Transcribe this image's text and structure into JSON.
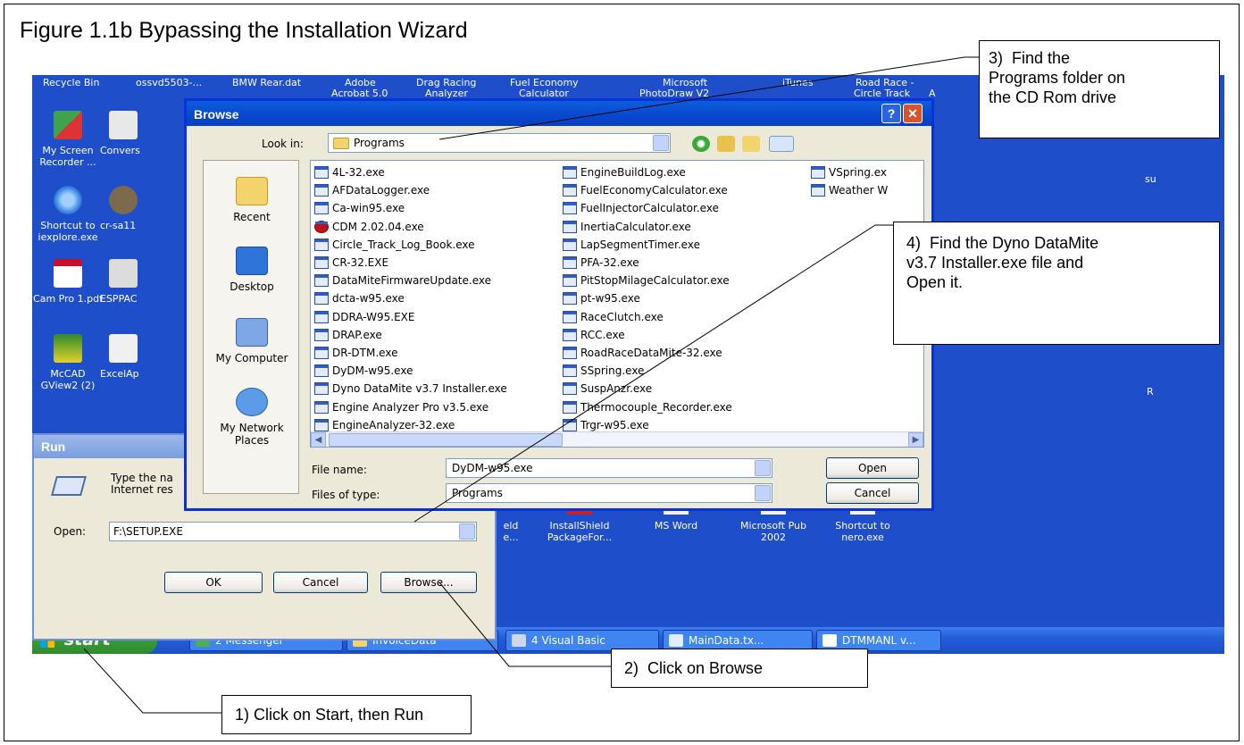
{
  "figure": {
    "title": "Figure 1.1b  Bypassing the Installation Wizard"
  },
  "desktop": {
    "top_row": [
      "Recycle Bin",
      "ossvd5503-...",
      "BMW Rear.dat",
      "Adobe",
      "Drag Racing",
      "Fuel Economy",
      "Microsoft",
      "iTunes",
      "Road Race -"
    ],
    "top_row_sub": [
      "Acrobat 5.0",
      "Analyzer",
      "Calculator",
      "PhotoDraw V2",
      "Circle Track"
    ],
    "icons": [
      {
        "label": "My Screen Recorder ...",
        "name": "screen-recorder-icon"
      },
      {
        "label": "Convers",
        "name": "converter-icon"
      },
      {
        "label": "Shortcut to iexplore.exe",
        "name": "internet-explorer-icon"
      },
      {
        "label": "cr-sa11",
        "name": "cr-sa11-icon"
      },
      {
        "label": "Cam Pro 1.pdf",
        "name": "pdf-icon"
      },
      {
        "label": "ESPPAC",
        "name": "esppac-icon"
      },
      {
        "label": "McCAD GView2 (2)",
        "name": "mccad-icon"
      },
      {
        "label": "ExcelAp",
        "name": "excel-icon"
      }
    ],
    "bottom_icons": [
      "eld",
      "InstallShield PackageFor...",
      "MS Word",
      "Microsoft Pub 2002",
      "Shortcut to nero.exe"
    ],
    "bottom_icons_sub": [
      "e..."
    ],
    "edge_chars": [
      "A",
      "su",
      "R"
    ]
  },
  "taskbar": {
    "start_label": "start",
    "tasks": [
      "2 Messenger",
      "InvoiceData",
      "4 Visual Basic",
      "MainData.tx...",
      "DTMMANL v..."
    ]
  },
  "run_dialog": {
    "title": "Run",
    "description_line1": "Type the na",
    "description_line2": "Internet res",
    "open_label": "Open:",
    "open_value": "F:\\SETUP.EXE",
    "ok_label": "OK",
    "cancel_label": "Cancel",
    "browse_label": "Browse..."
  },
  "browse_dialog": {
    "title": "Browse",
    "help_label": "?",
    "close_label": "✕",
    "look_in_label": "Look in:",
    "look_in_value": "Programs",
    "places": [
      "Recent",
      "Desktop",
      "My Computer",
      "My Network Places"
    ],
    "files_col1": [
      "4L-32.exe",
      "AFDataLogger.exe",
      "Ca-win95.exe",
      "CDM 2.02.04.exe",
      "Circle_Track_Log_Book.exe",
      "CR-32.EXE",
      "DataMiteFirmwareUpdate.exe",
      "dcta-w95.exe",
      "DDRA-W95.EXE",
      "DRAP.exe",
      "DR-DTM.exe",
      "DyDM-w95.exe",
      "Dyno DataMite v3.7 Installer.exe",
      "Engine Analyzer Pro v3.5.exe",
      "EngineAnalyzer-32.exe"
    ],
    "files_col2": [
      "EngineBuildLog.exe",
      "FuelEconomyCalculator.exe",
      "FuelInjectorCalculator.exe",
      "InertiaCalculator.exe",
      "LapSegmentTimer.exe",
      "PFA-32.exe",
      "PitStopMilageCalculator.exe",
      "pt-w95.exe",
      "RaceClutch.exe",
      "RCC.exe",
      "RoadRaceDataMite-32.exe",
      "SSpring.exe",
      "SuspAnzr.exe",
      "Thermocouple_Recorder.exe",
      "Trgr-w95.exe"
    ],
    "files_col3": [
      "VSpring.ex",
      "Weather W"
    ],
    "file_name_label": "File name:",
    "file_name_value": "DyDM-w95.exe",
    "files_of_type_label": "Files of type:",
    "files_of_type_value": "Programs",
    "open_label": "Open",
    "cancel_label": "Cancel"
  },
  "callouts": {
    "step1": "1) Click on Start, then Run",
    "step2": "2)  Click on Browse",
    "step3": "3)  Find the\nPrograms folder on\nthe CD Rom drive",
    "step4": "4)  Find the Dyno DataMite\nv3.7 Installer.exe file and\nOpen it."
  }
}
